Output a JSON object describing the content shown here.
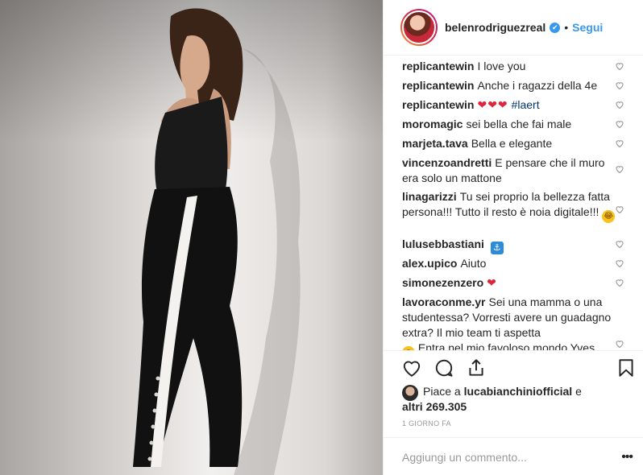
{
  "post": {
    "author": "belenrodriguezreal",
    "verified_mark": "✔",
    "separator": "•",
    "follow_label": "Segui"
  },
  "comments": [
    {
      "user": "replicantewin",
      "text": "I love you"
    },
    {
      "user": "replicantewin",
      "text": "Anche i ragazzi della 4e"
    },
    {
      "user": "replicantewin",
      "text": "❤❤❤",
      "tag": "#laert"
    },
    {
      "user": "moromagic",
      "text": "sei bella che fai male"
    },
    {
      "user": "marjeta.tava",
      "text": "Bella e elegante"
    },
    {
      "user": "vincenzoandretti",
      "text": "E pensare che il muro era solo un mattone"
    },
    {
      "user": "linagarizzi",
      "text": "Tu sei proprio la bellezza fatta persona!!! Tutto il resto è noia digitale!!!"
    },
    {
      "user": "lulusebbastiani",
      "text": ""
    },
    {
      "user": "alex.upico",
      "text": "Aiuto"
    },
    {
      "user": "simonezenzero",
      "text": "❤"
    },
    {
      "user": "lavoraconme.yr",
      "text": "Sei una mamma o una studentessa? Vorresti avere un guadagno extra? Il mio team ti aspetta",
      "text2": "Entra nel mio favoloso mondo Yves"
    }
  ],
  "likes": {
    "prefix": "Piace a",
    "user": "lucabianchiniofficial",
    "connector": "e",
    "others": "altri 269.305"
  },
  "timestamp": "1 GIORNO FA",
  "add_comment": {
    "placeholder": "Aggiungi un commento...",
    "more_label": "•••"
  },
  "icons": {
    "like": "heart-icon",
    "comment": "comment-icon",
    "share": "share-icon",
    "save": "bookmark-icon",
    "comment_like": "small-heart-icon"
  },
  "colors": {
    "link": "#3897f0",
    "heart_red": "#e0243d",
    "muted": "#999999",
    "border": "#efefef"
  }
}
